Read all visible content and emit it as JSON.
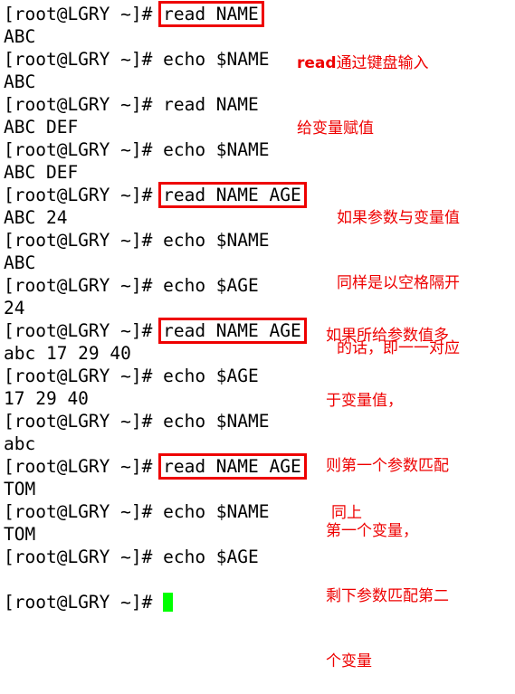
{
  "terminal": {
    "prompt": "[root@LGRY ~]# ",
    "lines": [
      {
        "type": "cmd",
        "text": "read NAME",
        "boxed": true
      },
      {
        "type": "out",
        "text": "ABC"
      },
      {
        "type": "cmd",
        "text": "echo $NAME",
        "boxed": false
      },
      {
        "type": "out",
        "text": "ABC"
      },
      {
        "type": "cmd",
        "text": "read NAME",
        "boxed": false
      },
      {
        "type": "out",
        "text": "ABC DEF"
      },
      {
        "type": "cmd",
        "text": "echo $NAME",
        "boxed": false
      },
      {
        "type": "out",
        "text": "ABC DEF"
      },
      {
        "type": "cmd",
        "text": "read NAME AGE",
        "boxed": true
      },
      {
        "type": "out",
        "text": "ABC 24"
      },
      {
        "type": "cmd",
        "text": "echo $NAME",
        "boxed": false
      },
      {
        "type": "out",
        "text": "ABC"
      },
      {
        "type": "cmd",
        "text": "echo $AGE",
        "boxed": false
      },
      {
        "type": "out",
        "text": "24"
      },
      {
        "type": "cmd",
        "text": "read NAME AGE",
        "boxed": true
      },
      {
        "type": "out",
        "text": "abc 17 29 40"
      },
      {
        "type": "cmd",
        "text": "echo $AGE",
        "boxed": false
      },
      {
        "type": "out",
        "text": "17 29 40"
      },
      {
        "type": "cmd",
        "text": "echo $NAME",
        "boxed": false
      },
      {
        "type": "out",
        "text": "abc"
      },
      {
        "type": "cmd",
        "text": "read NAME AGE",
        "boxed": true
      },
      {
        "type": "out",
        "text": "TOM"
      },
      {
        "type": "cmd",
        "text": "echo $NAME",
        "boxed": false
      },
      {
        "type": "out",
        "text": "TOM"
      },
      {
        "type": "cmd",
        "text": "echo $AGE",
        "boxed": false
      },
      {
        "type": "out",
        "text": ""
      },
      {
        "type": "prompt",
        "text": ""
      }
    ],
    "cursor_color": "#00ff00"
  },
  "annotations": [
    {
      "bold_prefix": "read",
      "lines": [
        "通过键盘输入",
        "给变量赋值"
      ]
    },
    {
      "bold_prefix": "",
      "lines": [
        "如果参数与变量值",
        "同样是以空格隔开",
        "的话，即一一对应"
      ]
    },
    {
      "bold_prefix": "",
      "lines": [
        "如果所给参数值多",
        "于变量值，",
        "则第一个参数匹配",
        "第一个变量，",
        "剩下参数匹配第二",
        "个变量"
      ]
    },
    {
      "bold_prefix": "",
      "lines": [
        "同上"
      ]
    }
  ],
  "colors": {
    "annotation": "#ee0000",
    "box_border": "#ee0000",
    "text": "#000000",
    "background": "#ffffff"
  }
}
